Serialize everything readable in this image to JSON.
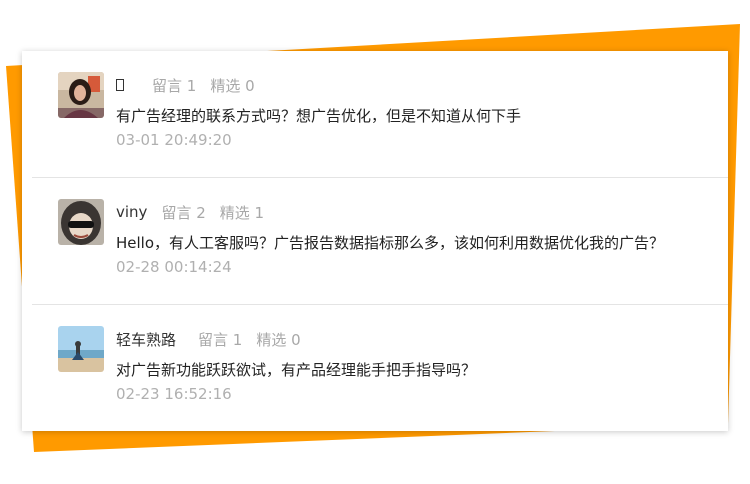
{
  "colors": {
    "accent": "#ff9900",
    "meta": "#a8a8a8",
    "time": "#b0b0b0"
  },
  "comments": [
    {
      "username": "",
      "messages_label": "留言 1",
      "featured_label": "精选 0",
      "text": "有广告经理的联系方式吗？想广告优化，但是不知道从何下手",
      "time": "03-01 20:49:20",
      "avatar_icon": "avatar-woman-photo"
    },
    {
      "username": "viny",
      "messages_label": "留言 2",
      "featured_label": "精选 1",
      "text": "Hello，有人工客服吗？广告报告数据指标那么多，该如何利用数据优化我的广告？",
      "time": "02-28 00:14:24",
      "avatar_icon": "avatar-hooded-sunglasses"
    },
    {
      "username": "轻车熟路",
      "messages_label": "留言 1",
      "featured_label": "精选 0",
      "text": "对广告新功能跃跃欲试，有产品经理能手把手指导吗？",
      "time": "02-23 16:52:16",
      "avatar_icon": "avatar-beach-scene"
    }
  ]
}
